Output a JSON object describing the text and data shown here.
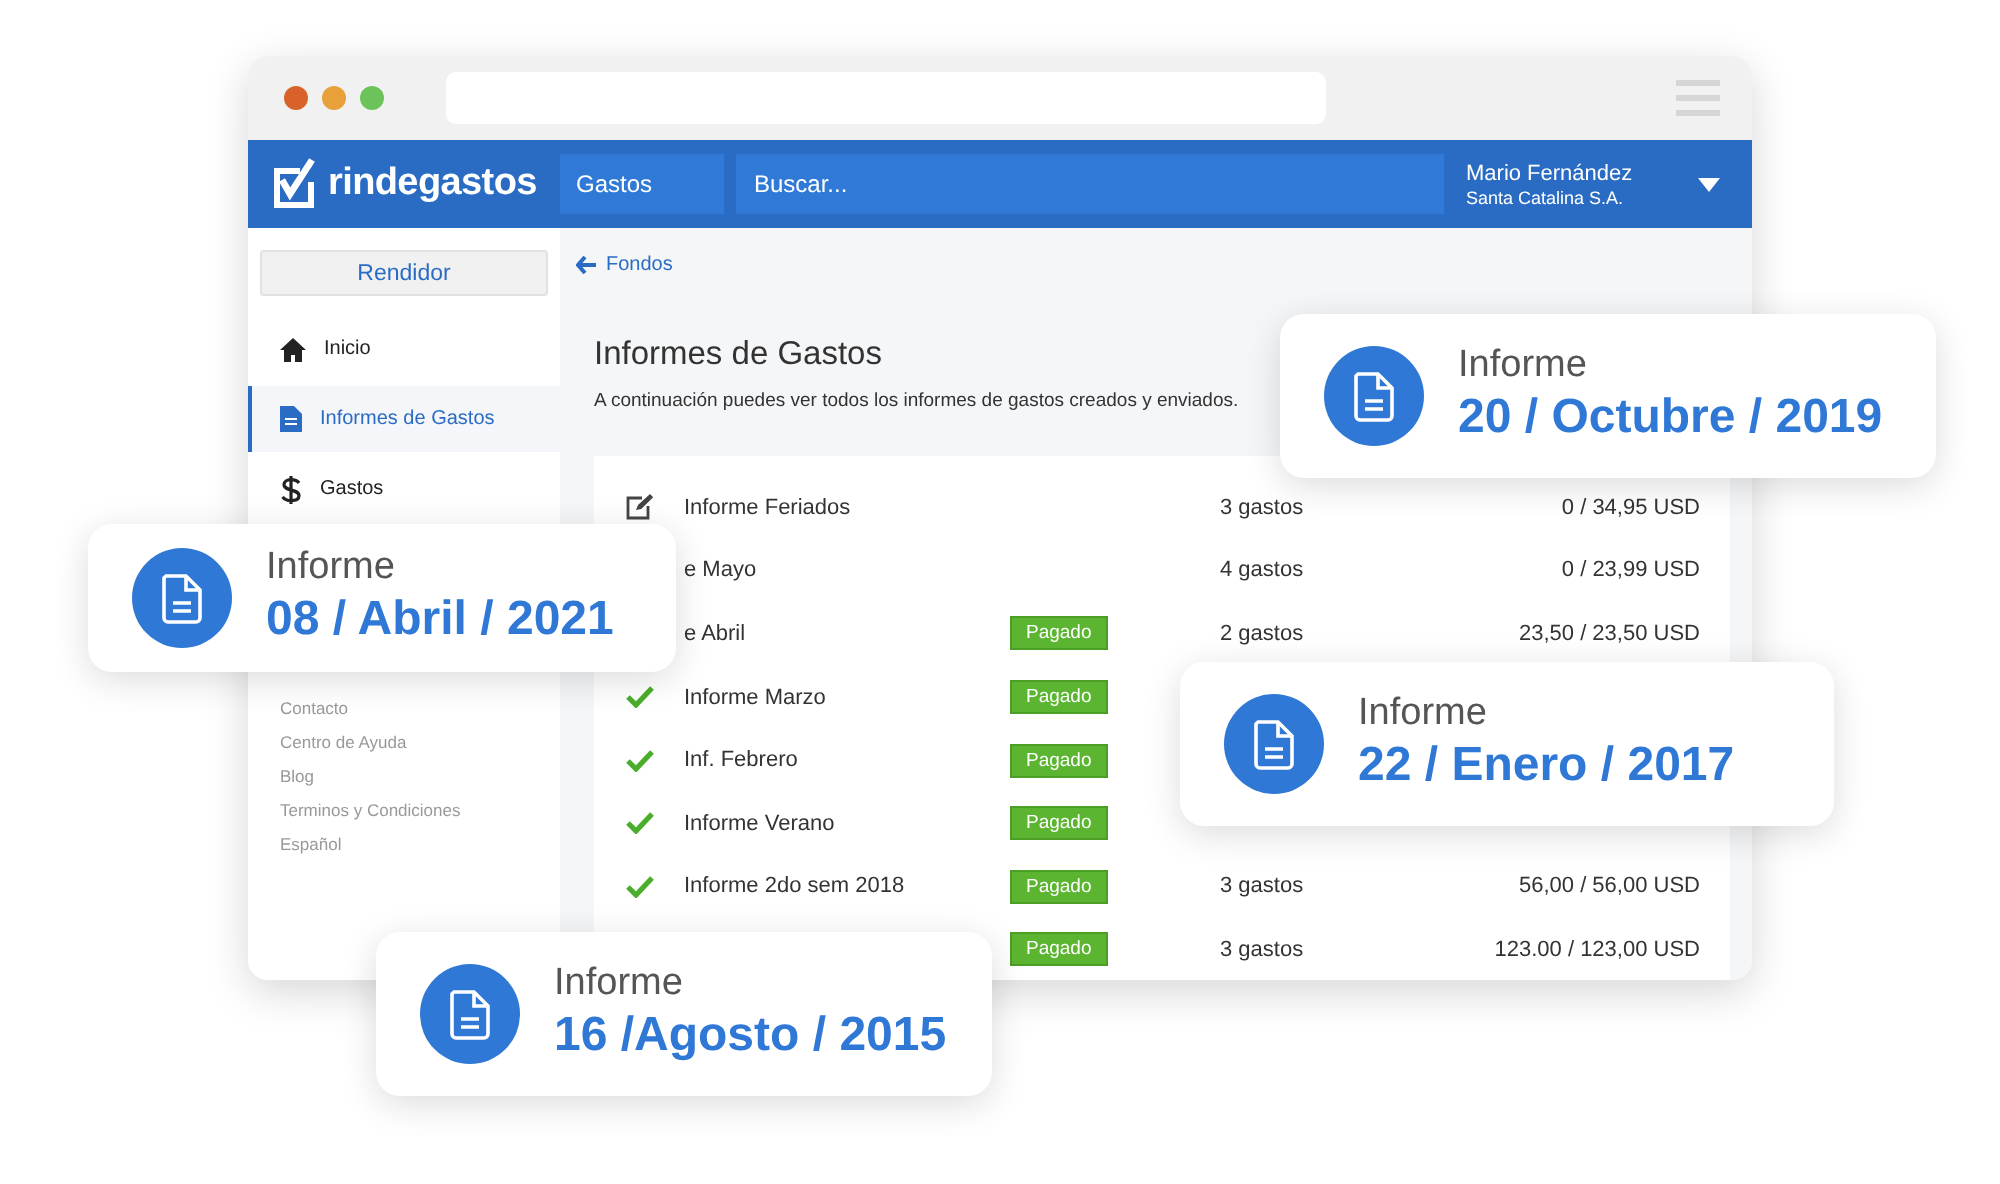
{
  "app_bar": {
    "logo": "rindegastos",
    "section": "Gastos",
    "search": {
      "placeholder": "Buscar..."
    },
    "user": {
      "name": "Mario Fernández",
      "company": "Santa Catalina S.A."
    }
  },
  "sidebar": {
    "role_button": "Rendidor",
    "items": [
      {
        "kind": "home",
        "label": "Inicio",
        "selected": false
      },
      {
        "kind": "document",
        "label": "Informes de Gastos",
        "selected": true
      },
      {
        "kind": "dollar",
        "label": "Gastos",
        "selected": false
      }
    ],
    "footer_links": [
      "Contacto",
      "Centro de Ayuda",
      "Blog",
      "Terminos y Condiciones",
      "Español"
    ]
  },
  "breadcrumb": "Fondos",
  "page": {
    "title": "Informes de Gastos",
    "subtitle": "A continuación puedes ver todos los informes de gastos creados y enviados."
  },
  "rows": [
    {
      "kind": "edit",
      "name": "Informe Feriados",
      "count": "3 gastos",
      "amount": "0 / 34,95 USD"
    },
    {
      "name": "e Mayo",
      "count": "4 gastos",
      "amount": "0 / 23,99 USD"
    },
    {
      "name": "e Abril",
      "status": "Pagado",
      "count": "2 gastos",
      "amount": "23,50 / 23,50 USD"
    },
    {
      "kind": "check",
      "name": "Informe Marzo",
      "status": "Pagado"
    },
    {
      "kind": "check",
      "name": "Inf. Febrero",
      "status": "Pagado"
    },
    {
      "kind": "check",
      "name": "Informe Verano",
      "status": "Pagado"
    },
    {
      "kind": "check",
      "name": "Informe 2do sem 2018",
      "status": "Pagado",
      "count": "3 gastos",
      "amount": "56,00 / 56,00 USD"
    },
    {
      "status": "Pagado",
      "count": "3 gastos",
      "amount": "123.00 / 123,00 USD"
    }
  ],
  "cards": [
    {
      "label": "Informe",
      "date": "20 / Octubre / 2019"
    },
    {
      "label": "Informe",
      "date": "08 / Abril / 2021"
    },
    {
      "label": "Informe",
      "date": "22 / Enero / 2017"
    },
    {
      "label": "Informe",
      "date": "16 /Agosto / 2015"
    }
  ]
}
